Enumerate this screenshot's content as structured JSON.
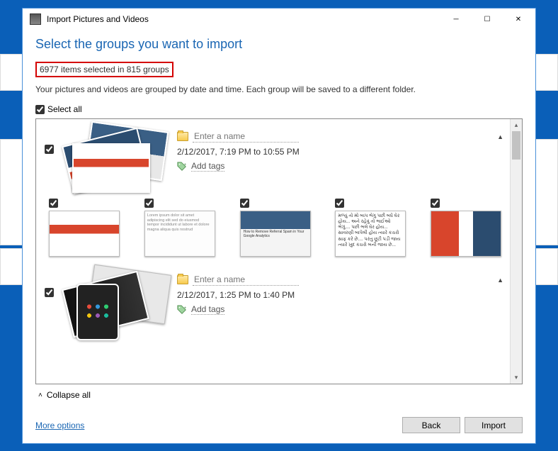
{
  "window": {
    "title": "Import Pictures and Videos"
  },
  "heading": "Select the groups you want to import",
  "summary": "6977 items selected in 815 groups",
  "description": "Your pictures and videos are grouped by date and time. Each group will be saved to a different folder.",
  "select_all_label": "Select all",
  "groups": [
    {
      "name_placeholder": "Enter a name",
      "date_range": "2/12/2017, 7:19 PM to 10:55 PM",
      "add_tags_label": "Add tags",
      "thumbs": [
        {
          "kind": "red"
        },
        {
          "kind": "text",
          "content": "Lorem ipsum dolor sit amet adipiscing elit sed do eiusmod tempor incididunt ut labore et dolore magna aliqua quis nostrud"
        },
        {
          "kind": "ga"
        },
        {
          "kind": "guj",
          "content": "મળ્યું તો મો બાપ ભેગુ પછી બધે ઘેર હોય... અને રહેવું તો ભાઈઓ ભેગું.... પછી ભલે ઘેર હોય... સાવરણી બાપેલી હોય ત્યારે કચરો સાફ કરે છે.... પરંતુ છૂટી પડી જાય ત્યારે ખુદ કચરો બની જાય છે..."
        },
        {
          "kind": "red2"
        }
      ]
    },
    {
      "name_placeholder": "Enter a name",
      "date_range": "2/12/2017, 1:25 PM to 1:40 PM",
      "add_tags_label": "Add tags"
    }
  ],
  "collapse_label": "Collapse all",
  "footer": {
    "more_options": "More options",
    "back": "Back",
    "import": "Import"
  }
}
